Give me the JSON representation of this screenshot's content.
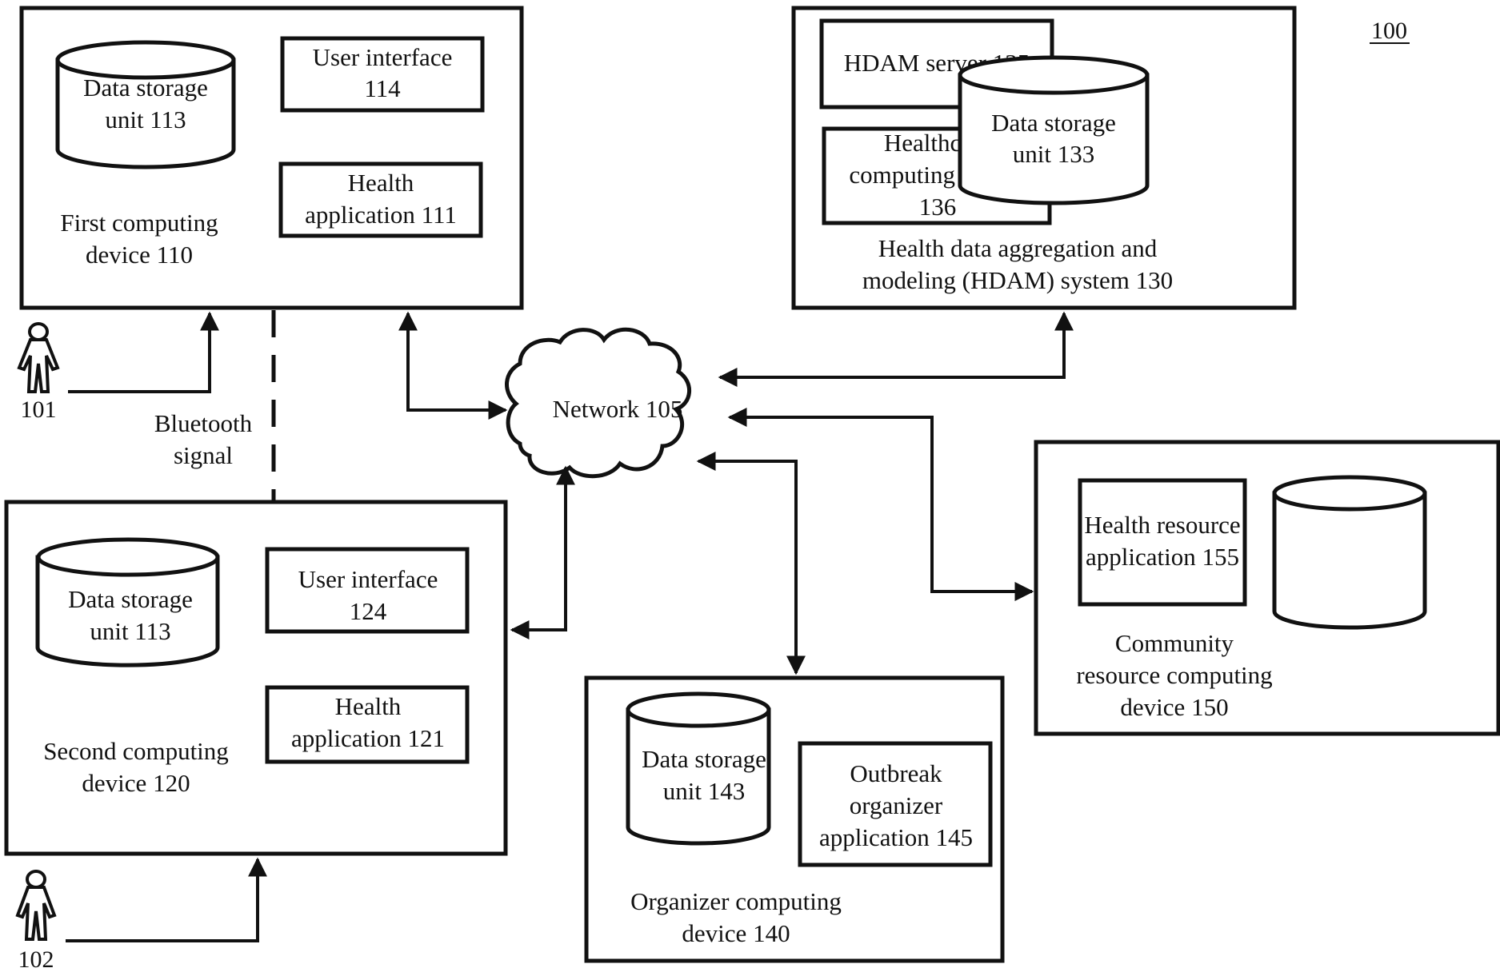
{
  "figure": {
    "ref_label": "100"
  },
  "network": {
    "label": "Network 105"
  },
  "users": [
    {
      "label": "101"
    },
    {
      "label": "102"
    }
  ],
  "bluetooth": {
    "line1": "Bluetooth",
    "line2": "signal"
  },
  "first_device": {
    "title_line1": "First computing",
    "title_line2": "device 110",
    "storage": {
      "line1": "Data storage",
      "line2": "unit 113"
    },
    "ui": {
      "line1": "User interface",
      "line2": "114"
    },
    "app": {
      "line1": "Health",
      "line2": "application 111"
    }
  },
  "second_device": {
    "title_line1": "Second computing",
    "title_line2": "device 120",
    "storage": {
      "line1": "Data storage",
      "line2": "unit 113"
    },
    "ui": {
      "line1": "User interface",
      "line2": "124"
    },
    "app": {
      "line1": "Health",
      "line2": "application 121"
    }
  },
  "hdam_system": {
    "title_line1": "Health data aggregation and",
    "title_line2": "modeling (HDAM) system 130",
    "server": {
      "line1": "HDAM server 135"
    },
    "healthcare_device": {
      "line1": "Healthcare",
      "line2": "computing device",
      "line3": "136"
    },
    "storage": {
      "line1": "Data storage",
      "line2": "unit 133"
    }
  },
  "organizer_device": {
    "title_line1": "Organizer computing",
    "title_line2": "device 140",
    "storage": {
      "line1": "Data storage",
      "line2": "unit 143"
    },
    "app": {
      "line1": "Outbreak",
      "line2": "organizer",
      "line3": "application 145"
    }
  },
  "community_device": {
    "title_line1": "Community",
    "title_line2": "resource computing",
    "title_line3": "device 150",
    "app": {
      "line1": "Health resource",
      "line2": "application  155"
    }
  }
}
